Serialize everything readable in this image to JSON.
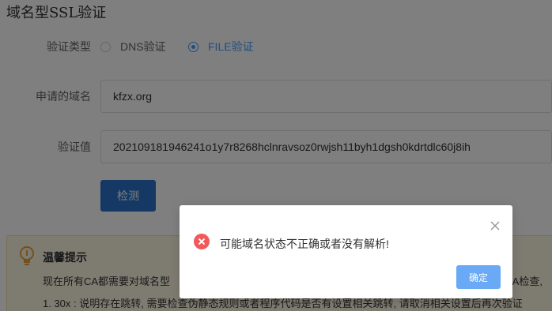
{
  "page": {
    "title": "域名型SSL验证"
  },
  "form": {
    "verify_type_label": "验证类型",
    "options": [
      {
        "label": "DNS验证",
        "checked": false
      },
      {
        "label": "FILE验证",
        "checked": true
      }
    ],
    "domain_label": "申请的域名",
    "domain_value": "kfzx.org",
    "verify_value_label": "验证值",
    "verify_value": "202109181946241o1y7r8268hclnravsoz0rwjsh11byh1dgsh0kdrtdlc60j8ih",
    "check_button": "检测"
  },
  "tips": {
    "title": "温馨提示",
    "line1": "现在所有CA都需要对域名型",
    "line1_right": "AA检查,",
    "line2": "1. 30x : 说明存在跳转, 需要检查伪静态规则或者程序代码是否有设置相关跳转, 请取消相关设置后再次验证"
  },
  "dialog": {
    "message": "可能域名状态不正确或者没有解析!",
    "ok_button": "确定"
  },
  "colors": {
    "primary": "#2a73c9",
    "radio_checked": "#409eff",
    "error": "#f05a5a",
    "dialog_ok": "#69a9f5",
    "tips_bg": "#fdf6e3"
  },
  "icons": {
    "tips": "lightbulb-icon",
    "dialog": "error-x-icon",
    "close": "close-icon"
  }
}
